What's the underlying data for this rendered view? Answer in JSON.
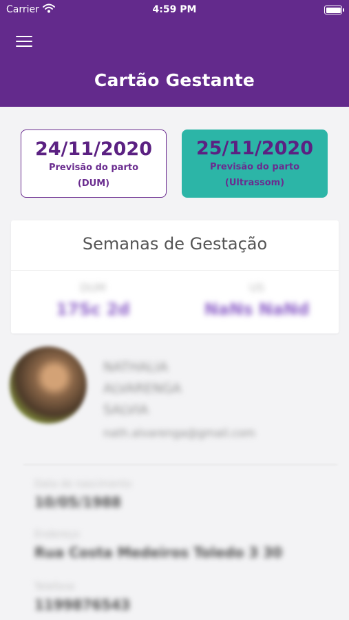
{
  "status_bar": {
    "carrier": "Carrier",
    "time": "4:59 PM",
    "wifi_icon": "wifi-icon",
    "battery_icon": "battery-icon"
  },
  "header": {
    "menu_icon": "hamburger-menu-icon",
    "title": "Cartão Gestante",
    "background": "#632a8c"
  },
  "due_dates": {
    "dum": {
      "date": "24/11/2020",
      "label": "Previsão do parto",
      "method": "(DUM)"
    },
    "ultrasound": {
      "date": "25/11/2020",
      "label": "Previsão do parto",
      "method": "(Ultrassom)",
      "color": "#2cb5a7"
    }
  },
  "gestation": {
    "title": "Semanas de Gestação",
    "left": {
      "caption": "DUM",
      "value": "17Sc 2d"
    },
    "right": {
      "caption": "US",
      "value": "NaNs NaNd"
    }
  },
  "profile": {
    "line1": "NATHALIA",
    "line2": "ALVARENGA",
    "line3": "SALVIA",
    "email": "nath.alvarenga@gmail.com"
  },
  "fields": [
    {
      "label": "Data de nascimento",
      "value": "10/05/1988"
    },
    {
      "label": "Endereço",
      "value": "Rua Costa Medeiros Toledo 3 30"
    },
    {
      "label": "Telefone",
      "value": "1199876543"
    }
  ]
}
